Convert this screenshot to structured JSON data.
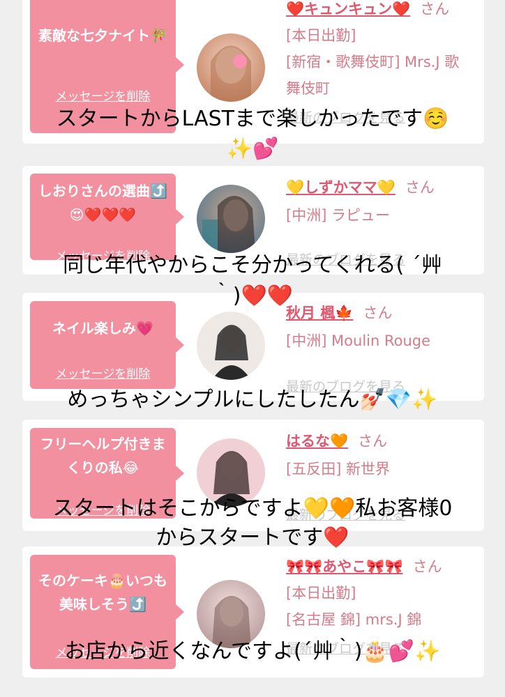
{
  "cards": [
    {
      "message": "素敵な七夕ナイト🎋",
      "delete_label": "メッセージを削除",
      "name": "❤️キュンキュン❤️",
      "suffix": "さん",
      "status": "[本日出勤]",
      "shop": "[新宿・歌舞伎町] Mrs.J 歌舞伎町",
      "blog_link": "最新のブログを見る",
      "avatar_colors": [
        "#c98a6a",
        "#f4d2c2"
      ]
    },
    {
      "message": "しおりさんの選曲⤴️😍❤️❤️❤️",
      "delete_label": "メッセージを削除",
      "name": "💛しずかママ💛",
      "suffix": "さん",
      "shop": "[中洲] ラピュー",
      "blog_link": "最新のブログを見る",
      "avatar_colors": [
        "#5a7a8f",
        "#c7a58d"
      ]
    },
    {
      "message": "ネイル楽しみ💗",
      "delete_label": "メッセージを削除",
      "name": "秋月 楓🍁",
      "suffix": "さん",
      "shop": "[中洲] Moulin Rouge",
      "blog_link": "最新のブログを見る",
      "avatar_colors": [
        "#2a2a2a",
        "#efe9e6"
      ]
    },
    {
      "message": "フリーヘルプ付きまくりの私😂",
      "delete_label": "メッセージを削除",
      "name": "はるな🧡",
      "suffix": "さん",
      "shop": "[五反田] 新世界",
      "blog_link": "最新のブログを見る",
      "avatar_colors": [
        "#3b2a2a",
        "#f0d0d4"
      ]
    },
    {
      "message": "そのケーキ🎂いつも美味しそう⤴️",
      "delete_label": "メッセージを削除",
      "name": "🎀🎀あやこ🎀🎀",
      "suffix": "さん",
      "status": "[本日出勤]",
      "shop": "[名古屋 錦] mrs.J 錦",
      "blog_link": "最新のブログを見る",
      "avatar_colors": [
        "#b79a9a",
        "#f2dede"
      ]
    }
  ],
  "overlays": [
    "スタートからLASTまで楽しかったです☺️",
    "✨💕",
    "同じ年代やからこそ分かってくれる( ´艸",
    "｀)❤️❤️",
    "めっちゃシンプルにしたしたん💅🏻💎✨",
    "スタートはそこからですよ💛🧡私お客様0",
    "からスタートです❤️",
    "お店から近くなんですよ(´艸｀)🎂💕✨"
  ],
  "colors": {
    "background": "#efefef",
    "bubble": "#f3909f",
    "name": "#e0576f",
    "info_text": "#d77b8a",
    "blog_link": "#c8c8c8"
  }
}
